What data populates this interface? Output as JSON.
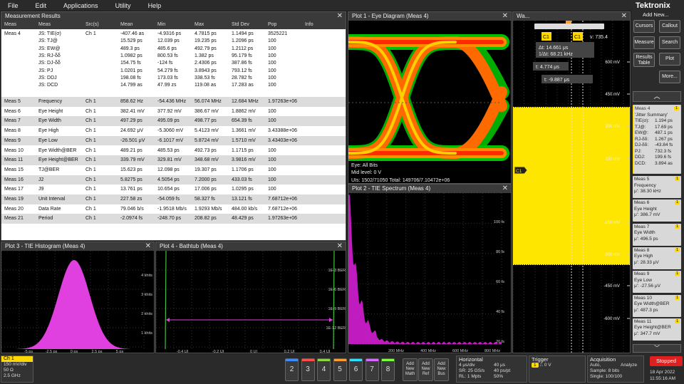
{
  "menu": [
    "File",
    "Edit",
    "Applications",
    "Utility",
    "Help"
  ],
  "meas_panel": {
    "title": "Measurement Results",
    "headers": [
      "Meas",
      "Src(s)",
      "Mean",
      "Min",
      "Max",
      "Std Dev",
      "Pop",
      "Info"
    ],
    "meas4": {
      "label": "Meas 4",
      "src": "Ch 1",
      "names": [
        "JS: TIE(σ)",
        "JS: TJ@",
        "JS: EW@",
        "JS: RJ-δδ",
        "JS: DJ-δδ",
        "JS: PJ",
        "JS: DDJ",
        "JS: DCD"
      ],
      "mean": [
        "-407.46 as",
        "15.529 ps",
        "489.3 ps",
        "1.0982 ps",
        "154.75 fs",
        "1.0201 ps",
        "198.08 fs",
        "14.799 as"
      ],
      "min": [
        "-4.9316 ps",
        "12.039 ps",
        "485.6 ps",
        "800.53 fs",
        "-124 fs",
        "54.279 fs",
        "173.03 fs",
        "47.99 zs"
      ],
      "max": [
        "4.7815 ps",
        "19.235 ps",
        "492.79 ps",
        "1.382 ps",
        "2.4306 ps",
        "3.8943 ps",
        "338.53 fs",
        "119.08 as"
      ],
      "std": [
        "1.1494 ps",
        "1.2096 ps",
        "1.2112 ps",
        "95.179 fs",
        "387.86 fs",
        "793.12 fs",
        "28.782 fs",
        "17.283 as"
      ],
      "pop": [
        "3525221",
        "100",
        "100",
        "100",
        "100",
        "100",
        "100",
        "100"
      ]
    },
    "rows": [
      [
        "Meas 5",
        "Frequency",
        "Ch 1",
        "858.62 Hz",
        "-54.436 MHz",
        "56.074 MHz",
        "12.684 MHz",
        "1.97263e+06"
      ],
      [
        "Meas 6",
        "Eye Height",
        "Ch 1",
        "382.41 mV",
        "377.92 mV",
        "386.67 mV",
        "1.8862 mV",
        "100"
      ],
      [
        "Meas 7",
        "Eye Width",
        "Ch 1",
        "497.29 ps",
        "495.09 ps",
        "498.77 ps",
        "654.39 fs",
        "100"
      ],
      [
        "Meas 8",
        "Eye High",
        "Ch 1",
        "24.692 μV",
        "-5.3060 mV",
        "5.4123 mV",
        "1.3661 mV",
        "3.43388e+06"
      ],
      [
        "Meas 9",
        "Eye Low",
        "Ch 1",
        "-26.501 μV",
        "-6.1017 mV",
        "5.8724 mV",
        "1.5710 mV",
        "3.43403e+06"
      ],
      [
        "Meas 10",
        "Eye Width@BER",
        "Ch 1",
        "489.21 ps",
        "485.53 ps",
        "492.73 ps",
        "1.1715 ps",
        "100"
      ],
      [
        "Meas 11",
        "Eye Height@BER",
        "Ch 1",
        "339.79 mV",
        "329.81 mV",
        "348.68 mV",
        "3.9816 mV",
        "100"
      ],
      [
        "Meas 15",
        "TJ@BER",
        "Ch 1",
        "15.623 ps",
        "12.098 ps",
        "19.307 ps",
        "1.1706 ps",
        "100"
      ],
      [
        "Meas 16",
        "J2",
        "Ch 1",
        "5.8275 ps",
        "4.5054 ps",
        "7.2000 ps",
        "433.03 fs",
        "100"
      ],
      [
        "Meas 17",
        "J9",
        "Ch 1",
        "13.761 ps",
        "10.654 ps",
        "17.006 ps",
        "1.0295 ps",
        "100"
      ],
      [
        "Meas 19",
        "Unit Interval",
        "Ch 1",
        "227.58 zs",
        "-54.059 fs",
        "58.327 fs",
        "13.121 fs",
        "7.68712e+06"
      ],
      [
        "Meas 20",
        "Data Rate",
        "Ch 1",
        "79.046 b/s",
        "-1.9518 Mb/s",
        "1.9293 Mb/s",
        "484.00 kb/s",
        "7.68712e+06"
      ],
      [
        "Meas 21",
        "Period",
        "Ch 1",
        "-2.0974 fs",
        "-248.70 ps",
        "208.82 ps",
        "48.429 ps",
        "1.97263e+06"
      ]
    ]
  },
  "plot1": {
    "title": "Plot 1 - Eye Diagram (Meas 4)",
    "eye_label": "Eye: All Bits",
    "mid_level": "Mid level:   0 V",
    "uis": "UIs:  1502/71050   Total:   149706/7.10472e+06"
  },
  "plot2": {
    "title": "Plot 2 - TIE Spectrum (Meas 4)",
    "xticks": [
      "200 MHz",
      "400 MHz",
      "600 MHz",
      "800 MHz"
    ],
    "yticks": [
      "100 fs",
      "80 fs",
      "60 fs",
      "40 fs",
      "20 fs"
    ]
  },
  "plot3": {
    "title": "Plot 3 - TIE Histogram (Meas 4)",
    "yticks": [
      "4 khits",
      "3 khits",
      "2 khits",
      "1 khits"
    ],
    "xticks": [
      "-5 ps",
      "-2.5 ps",
      "0 ps",
      "2.5 ps",
      "5 ps"
    ]
  },
  "plot4": {
    "title": "Plot 4 - Bathtub (Meas 4)",
    "yticks": [
      "1E-3 BER",
      "1E-6 BER",
      "1E-9 BER",
      "1E-12 BER"
    ],
    "xticks": [
      "-0.4 UI",
      "-0.2 UI",
      "0 UI",
      "0.2 UI",
      "0.4 UI"
    ]
  },
  "waveform": {
    "title": "Wa...",
    "cursor_dt": "Δt: 14.661 μs",
    "cursor_inv": "1/Δt: 68.21 kHz",
    "cursor_t1": "t: 4.774 μs",
    "cursor_t2": "t: -9.887 μs",
    "cursor_v": "v: 735.4",
    "ch_label": "C1",
    "y_labels": [
      "600 mV",
      "450 mV",
      "300 mV",
      "150 mV",
      "-150 mV",
      "-300 mV",
      "-450 mV",
      "-600 mV"
    ],
    "colors": {
      "signal": "#ffe600",
      "cursor": "#ffe600"
    }
  },
  "sidebar": {
    "brand": "Tektronix",
    "add_new": "Add New...",
    "buttons": [
      "Cursors",
      "Callout",
      "Measure",
      "Search",
      "Results Table",
      "Plot",
      "More..."
    ],
    "meas4": {
      "title": "Meas 4",
      "sub": "'Jitter Summary'",
      "lines": [
        [
          "TIE(σ):",
          "1.194 ps"
        ],
        [
          "TJ@:",
          "17.69 ps"
        ],
        [
          "EW@:",
          "487.1 ps"
        ],
        [
          "RJ-δδ:",
          "1.267 ps"
        ],
        [
          "DJ-δδ:",
          "-43.84 fs"
        ],
        [
          "PJ:",
          "732.3 fs"
        ],
        [
          "DDJ:",
          "199.6 fs"
        ],
        [
          "DCD:",
          "3.894 as"
        ]
      ]
    },
    "cards": [
      [
        "Meas 5",
        "Frequency",
        "μ': 38.30 kHz"
      ],
      [
        "Meas 6",
        "Eye Height",
        "μ': 386.7 mV"
      ],
      [
        "Meas 7",
        "Eye Width",
        "μ': 496.5 ps"
      ],
      [
        "Meas 8",
        "Eye High",
        "μ': 28.33 μV"
      ],
      [
        "Meas 9",
        "Eye Low",
        "μ': -27.56 μV"
      ],
      [
        "Meas 10",
        "Eye Width@BER",
        "μ': 487.3 ps"
      ],
      [
        "Meas 11",
        "Eye Height@BER",
        "μ': 347.7 mV"
      ]
    ]
  },
  "bottom": {
    "ch1": {
      "name": "Ch 1",
      "lines": [
        "150 mV/div",
        "50 Ω",
        "2.5 GHz"
      ]
    },
    "channels": [
      "2",
      "3",
      "4",
      "5",
      "6",
      "7",
      "8"
    ],
    "channel_colors": [
      "#3c8cff",
      "#ff4e4e",
      "#8cd446",
      "#ff9e2c",
      "#2ce0ff",
      "#d46cff",
      "#80ff40"
    ],
    "add": [
      "Add New Math",
      "Add New Ref",
      "Add New Bus"
    ],
    "horizontal": {
      "title": "Horizontal",
      "lines": [
        [
          "4 μs/div",
          "40 μs"
        ],
        [
          "SR: 25 GS/s",
          "40 ps/pt"
        ],
        [
          "RL: 1 Mpts",
          "50%"
        ]
      ]
    },
    "trigger": {
      "title": "Trigger",
      "level": "0 V"
    },
    "acquisition": {
      "title": "Acquisition",
      "lines": [
        [
          "Auto,",
          "Analyze"
        ],
        [
          "Sample: 8 bits",
          ""
        ],
        [
          "Single: 100/100",
          ""
        ]
      ]
    },
    "status": "Stopped",
    "date": "18 Apr 2022",
    "time": "11:55:16 AM"
  }
}
